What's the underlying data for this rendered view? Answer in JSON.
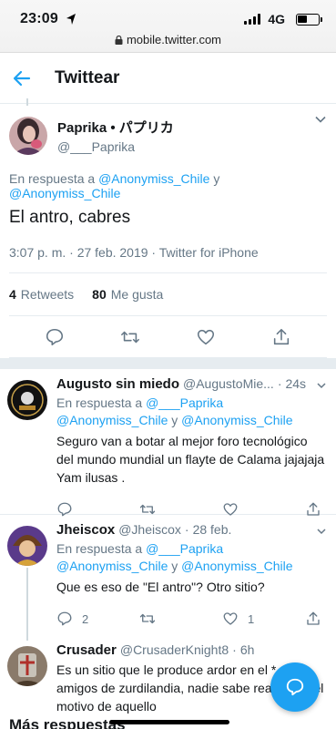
{
  "status": {
    "time": "23:09",
    "network": "4G",
    "url": "mobile.twitter.com"
  },
  "header": {
    "title": "Twittear"
  },
  "tweet": {
    "name": "Paprika • パプリカ",
    "handle": "@___Paprika",
    "reply_prefix": "En respuesta a",
    "reply_m1": "@Anonymiss_Chile",
    "reply_and": "y",
    "reply_m2": "@Anonymiss_Chile",
    "text": "El antro, cabres",
    "meta": "3:07 p. m. · 27 feb. 2019 · Twitter for iPhone",
    "retweets_count": "4",
    "retweets_label": "Retweets",
    "likes_count": "80",
    "likes_label": "Me gusta"
  },
  "replies": [
    {
      "name": "Augusto sin miedo",
      "handle": "@AugustoMie...",
      "dot": "·",
      "time": "24s",
      "reply_prefix": "En respuesta a",
      "m1": "@___Paprika",
      "m2": "@Anonymiss_Chile",
      "and": "y",
      "m3": "@Anonymiss_Chile",
      "text": "Seguro van a botar al mejor foro tecnológico del mundo mundial un flayte de Calama jajajaja Yam ilusas .",
      "reply_count": "",
      "like_count": ""
    },
    {
      "name": "Jheiscox",
      "handle": "@Jheiscox",
      "dot": "·",
      "time": "28 feb.",
      "reply_prefix": "En respuesta a",
      "m1": "@___Paprika",
      "m2": "@Anonymiss_Chile",
      "and": "y",
      "m3": "@Anonymiss_Chile",
      "text": "Que es eso de \"El antro\"? Otro sitio?",
      "reply_count": "2",
      "like_count": "1"
    },
    {
      "name": "Crusader",
      "handle": "@CrusaderKnight8",
      "dot": "·",
      "time": "6h",
      "text": "Es un sitio que le produce ardor en el * a los amigos de zurdilandia, nadie sabe realmente el motivo de aquello"
    }
  ],
  "more_replies": "Más respuestas",
  "colors": {
    "accent": "#1da1f2",
    "secondary_text": "#657786"
  }
}
